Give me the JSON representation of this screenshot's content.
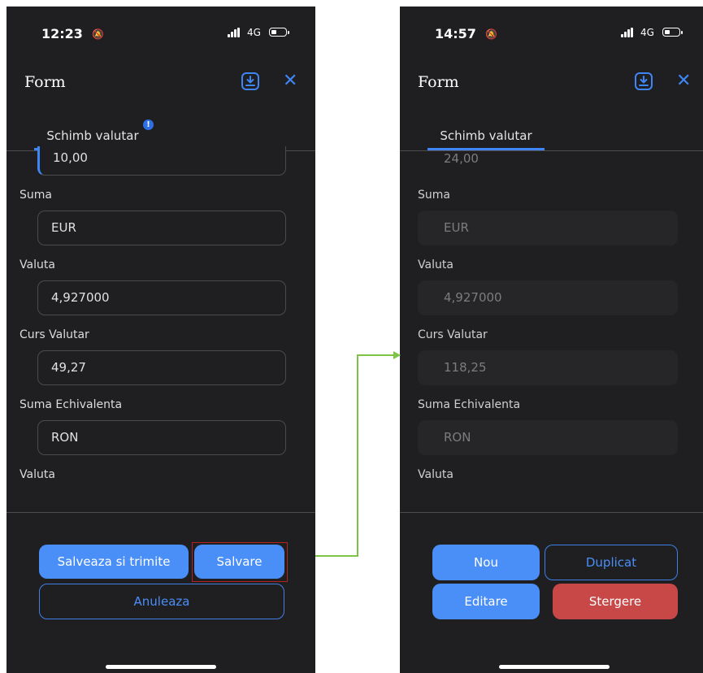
{
  "left": {
    "status": {
      "time": "12:23",
      "network": "4G"
    },
    "header": {
      "title": "Form"
    },
    "tab": {
      "label": "Schimb valutar",
      "badge": "!"
    },
    "fields": [
      {
        "value": "10,00",
        "label": "Suma"
      },
      {
        "value": "EUR",
        "label": "Valuta"
      },
      {
        "value": "4,927000",
        "label": "Curs Valutar"
      },
      {
        "value": "49,27",
        "label": "Suma Echivalenta"
      },
      {
        "value": "RON",
        "label": "Valuta"
      }
    ],
    "buttons": {
      "save_send": "Salveaza si trimite",
      "save": "Salvare",
      "cancel": "Anuleaza"
    }
  },
  "right": {
    "status": {
      "time": "14:57",
      "network": "4G"
    },
    "header": {
      "title": "Form"
    },
    "tab": {
      "label": "Schimb valutar"
    },
    "fields": [
      {
        "value": "24,00",
        "label": "Suma"
      },
      {
        "value": "EUR",
        "label": "Valuta"
      },
      {
        "value": "4,927000",
        "label": "Curs Valutar"
      },
      {
        "value": "118,25",
        "label": "Suma Echivalenta"
      },
      {
        "value": "RON",
        "label": "Valuta"
      }
    ],
    "buttons": {
      "new": "Nou",
      "duplicate": "Duplicat",
      "edit": "Editare",
      "delete": "Stergere"
    }
  },
  "colors": {
    "accent": "#4a8ef7",
    "danger": "#c84848",
    "arrow": "#7dc446",
    "highlight": "#b3241f",
    "background": "#1f1f21"
  }
}
